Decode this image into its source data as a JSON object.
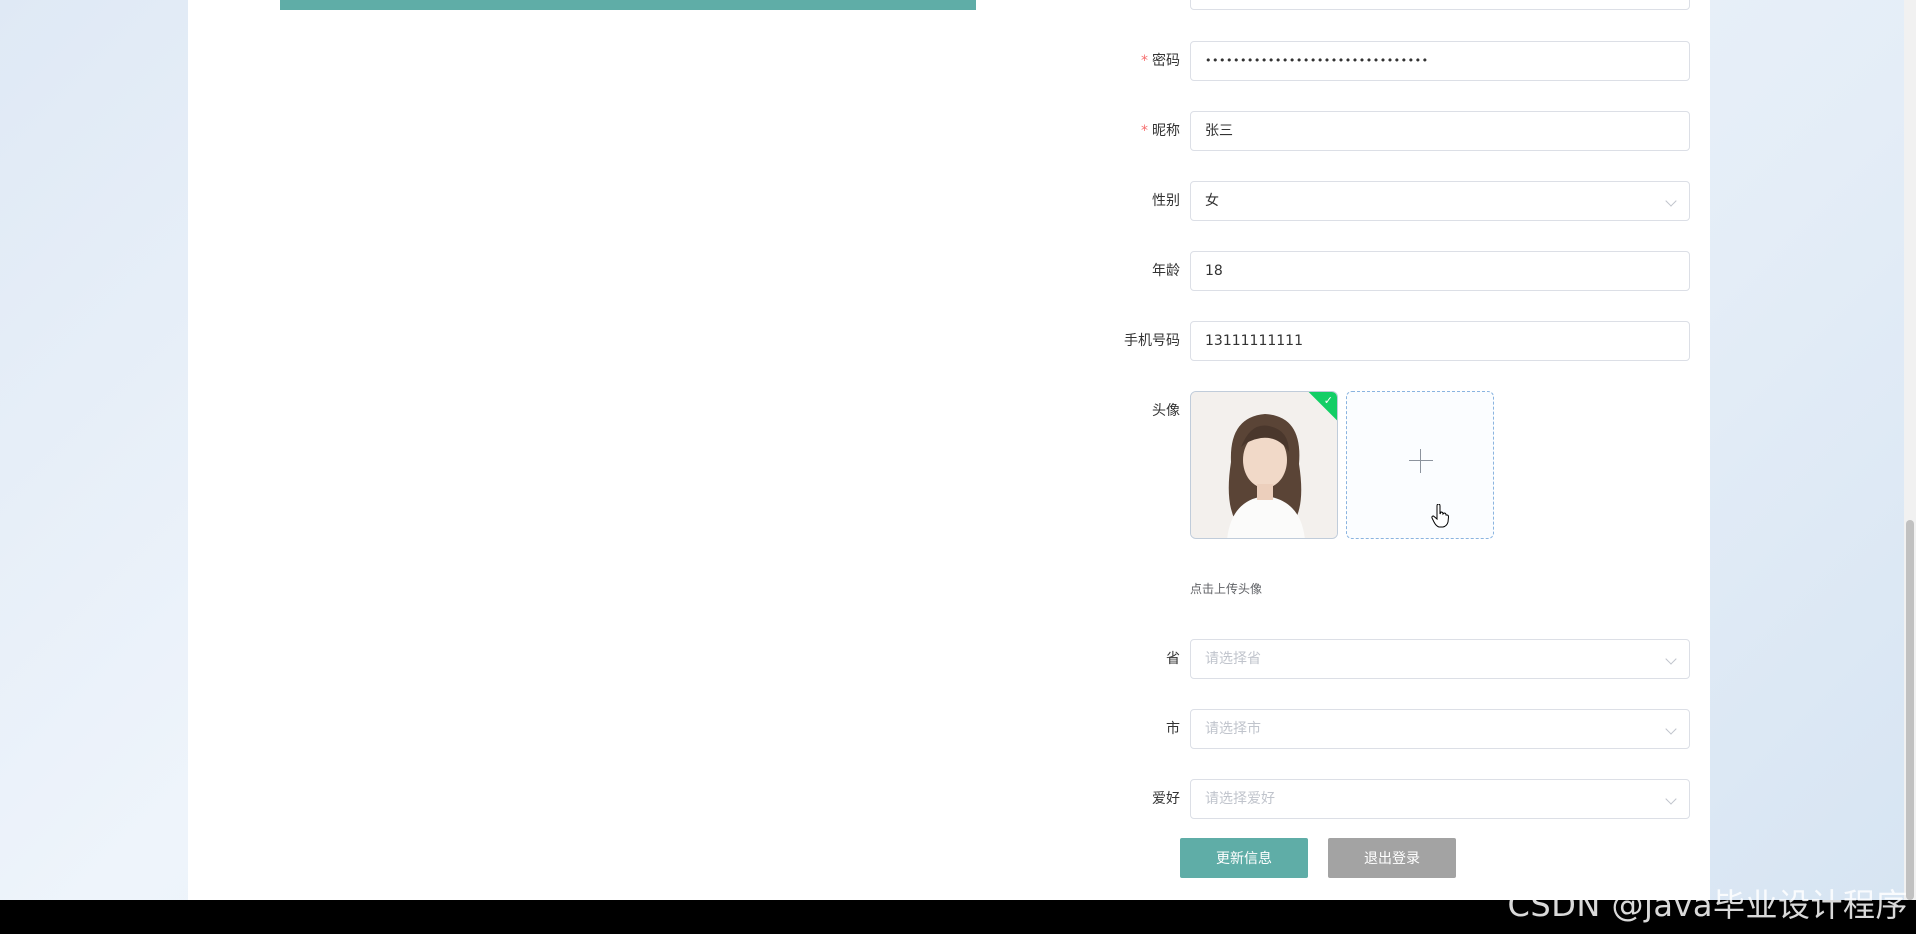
{
  "form": {
    "password": {
      "label": "密码",
      "required_mark": "*",
      "value": "••••••••••••••••••••••••••••••••"
    },
    "nickname": {
      "label": "昵称",
      "required_mark": "*",
      "value": "张三"
    },
    "gender": {
      "label": "性别",
      "value": "女"
    },
    "age": {
      "label": "年龄",
      "value": "18"
    },
    "phone": {
      "label": "手机号码",
      "value": "13111111111"
    },
    "avatar": {
      "label": "头像",
      "hint": "点击上传头像"
    },
    "province": {
      "label": "省",
      "placeholder": "请选择省"
    },
    "city": {
      "label": "市",
      "placeholder": "请选择市"
    },
    "hobby": {
      "label": "爱好",
      "placeholder": "请选择爱好"
    }
  },
  "buttons": {
    "update": "更新信息",
    "logout": "退出登录"
  },
  "watermark": "CSDN @java毕业设计程序",
  "colors": {
    "accent": "#5fada7",
    "logout": "#a3a3a3",
    "success": "#13ce66",
    "required": "#f56c6c"
  }
}
